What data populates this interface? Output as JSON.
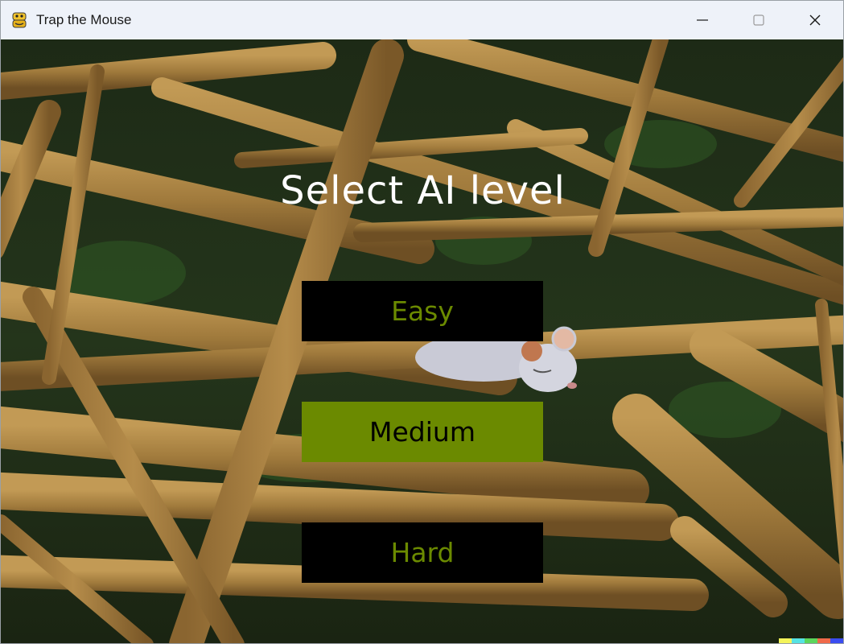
{
  "window": {
    "title": "Trap the Mouse",
    "app_icon": "python-snake-icon",
    "controls": [
      "minimize-icon",
      "maximize-icon",
      "close-icon"
    ]
  },
  "menu": {
    "heading": "Select AI level",
    "buttons": [
      {
        "label": "Easy",
        "state": "normal",
        "bg": "#000000",
        "fg": "#6b8a00"
      },
      {
        "label": "Medium",
        "state": "highlighted",
        "bg": "#6b8a00",
        "fg": "#000000"
      },
      {
        "label": "Hard",
        "state": "normal",
        "bg": "#000000",
        "fg": "#6b8a00"
      }
    ]
  },
  "colors": {
    "accent_green": "#6b8a00",
    "titlebar": "#eef2f9",
    "background_foliage": "#1f2f18",
    "branch": "#a07a3c"
  },
  "corner_strip_colors": [
    "#f4f45a",
    "#56e3e3",
    "#5cd65c",
    "#f06a4a",
    "#3a4cf0"
  ]
}
